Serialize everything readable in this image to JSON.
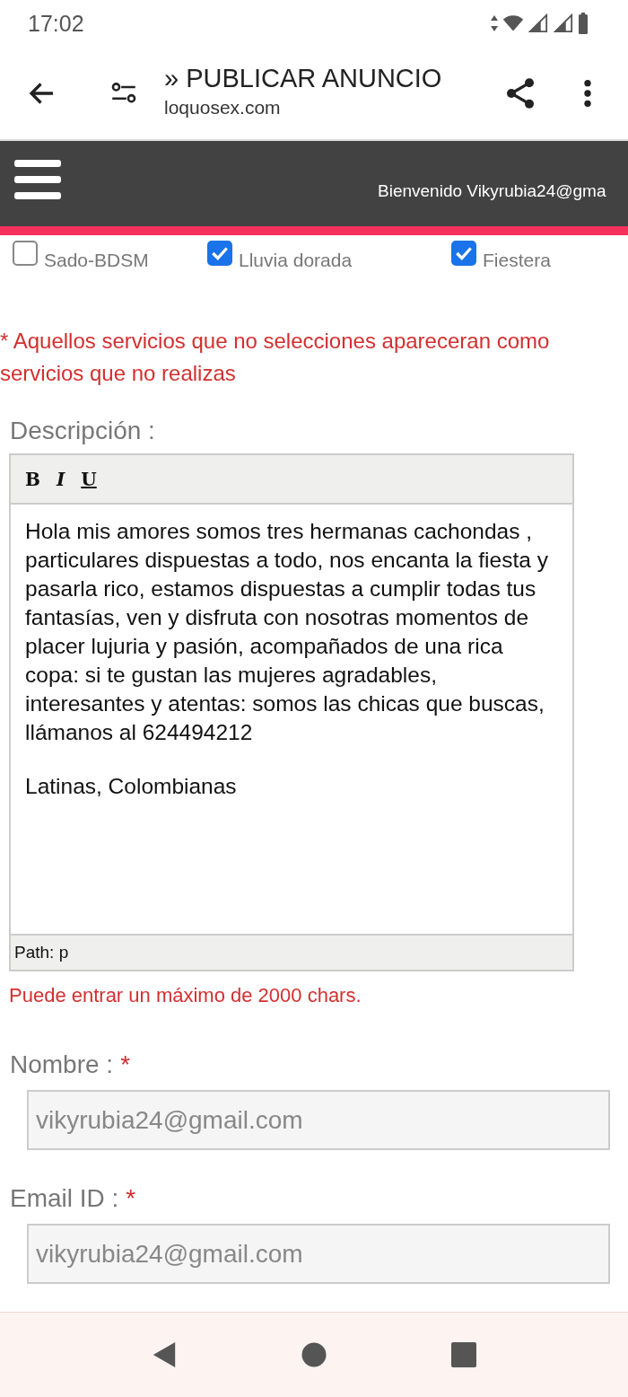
{
  "status_bar": {
    "time": "17:02"
  },
  "app_bar": {
    "title": "» PUBLICAR ANUNCIO",
    "subtitle": "loquosex.com"
  },
  "site_header": {
    "welcome": "Bienvenido Vikyrubia24@gma"
  },
  "services": [
    {
      "label": "Sado-BDSM",
      "checked": false
    },
    {
      "label": "Lluvia dorada",
      "checked": true
    },
    {
      "label": "Fiestera",
      "checked": true
    }
  ],
  "services_note": "* Aquellos servicios que no selecciones apareceran como servicios que no realizas",
  "description": {
    "label": "Descripción :",
    "toolbar": [
      "B",
      "I",
      "U"
    ],
    "paragraphs": [
      "Hola mis amores somos tres hermanas cachondas , particulares dispuestas a todo, nos encanta la fiesta y pasarla rico, estamos dispuestas a cumplir todas tus fantasías, ven y disfruta con nosotras momentos de placer lujuria y pasión, acompañados de una rica copa: si te gustan las mujeres agradables, interesantes y atentas: somos las chicas que buscas, llámanos al 624494212",
      "Latinas, Colombianas"
    ],
    "path": "Path: p",
    "limit_note": "Puede entrar un máximo de 2000 chars."
  },
  "fields": [
    {
      "label": "Nombre :",
      "required_mark": "*",
      "value": "vikyrubia24@gmail.com"
    },
    {
      "label": "Email ID :",
      "required_mark": "*",
      "value": "vikyrubia24@gmail.com"
    }
  ]
}
